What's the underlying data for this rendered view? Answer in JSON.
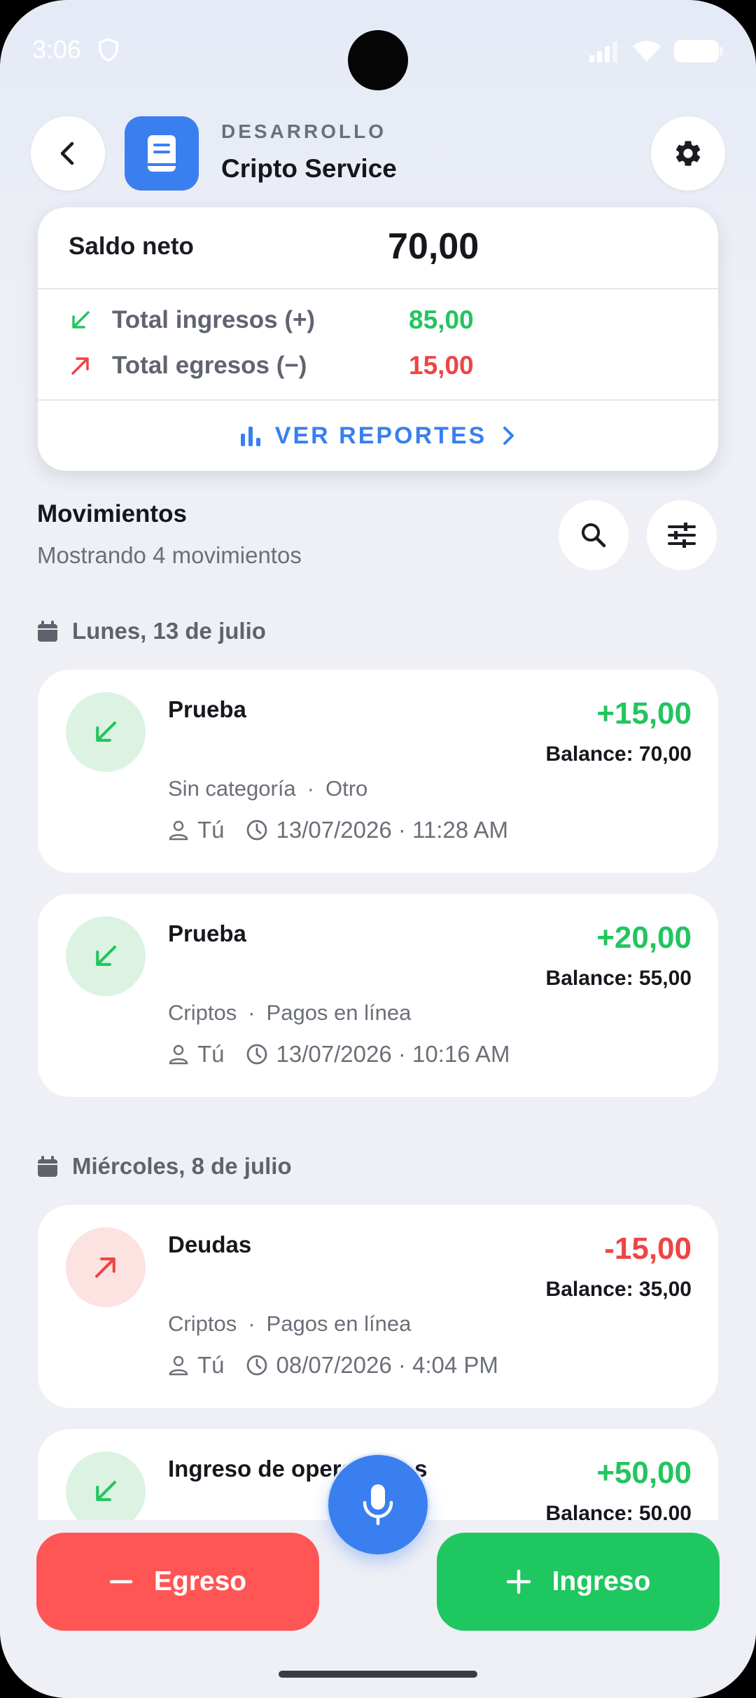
{
  "status_bar": {
    "time": "3:06"
  },
  "header": {
    "subtitle": "DESARROLLO",
    "title": "Cripto Service"
  },
  "summary": {
    "net_label": "Saldo neto",
    "net_value": "70,00",
    "income_label": "Total ingresos (+)",
    "income_value": "85,00",
    "expense_label": "Total egresos (−)",
    "expense_value": "15,00",
    "reports_label": "VER REPORTES"
  },
  "movements": {
    "title": "Movimientos",
    "subtitle": "Mostrando 4 movimientos"
  },
  "groups": [
    {
      "date": "Lunes, 13 de julio"
    },
    {
      "date": "Miércoles, 8 de julio"
    }
  ],
  "transactions": [
    {
      "title": "Prueba",
      "amount": "+15,00",
      "balance": "Balance: 70,00",
      "category": "Sin categoría",
      "subcategory": "Otro",
      "user": "Tú",
      "datetime": "13/07/2026 · 11:28 AM",
      "type": "in"
    },
    {
      "title": "Prueba",
      "amount": "+20,00",
      "balance": "Balance: 55,00",
      "category": "Criptos",
      "subcategory": "Pagos en línea",
      "user": "Tú",
      "datetime": "13/07/2026 · 10:16 AM",
      "type": "in"
    },
    {
      "title": "Deudas",
      "amount": "-15,00",
      "balance": "Balance: 35,00",
      "category": "Criptos",
      "subcategory": "Pagos en línea",
      "user": "Tú",
      "datetime": "08/07/2026 · 4:04 PM",
      "type": "out"
    },
    {
      "title": "Ingreso de operaciones",
      "amount": "+50,00",
      "balance": "Balance: 50,00",
      "type": "in"
    }
  ],
  "separator": "·",
  "actions": {
    "expense_label": "Egreso",
    "income_label": "Ingreso"
  },
  "colors": {
    "accent": "#3a7ff0",
    "income": "#22c55e",
    "expense": "#ef4444",
    "income_button": "#1ec760",
    "expense_button": "#ff5555"
  }
}
